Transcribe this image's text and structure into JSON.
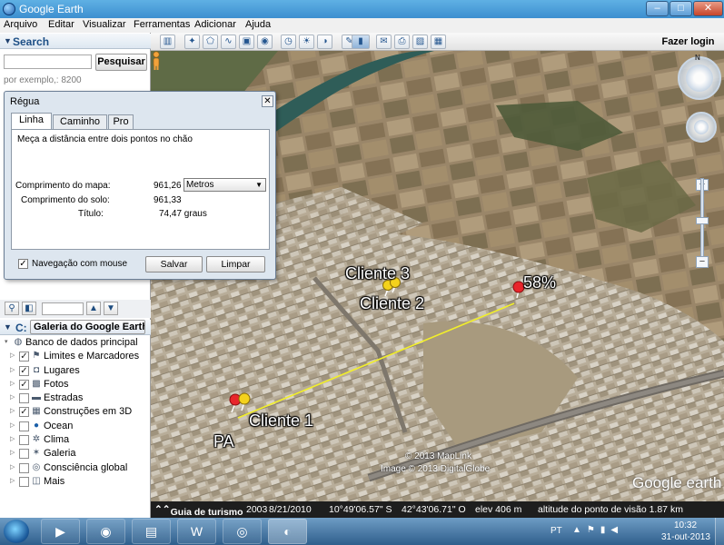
{
  "window": {
    "title": "Google Earth"
  },
  "menu": [
    "Arquivo",
    "Editar",
    "Visualizar",
    "Ferramentas",
    "Adicionar",
    "Ajuda"
  ],
  "search": {
    "header": "Search",
    "button": "Pesquisar",
    "hint": "por exemplo,: 8200"
  },
  "places": {
    "header_cut": "C:"
  },
  "layers": {
    "gallery_button": "Galeria do Google Earth",
    "gallery_chevron": "»",
    "items": [
      {
        "label": "Banco de dados principal",
        "checked": null,
        "icon": "globe-icon",
        "root": true
      },
      {
        "label": "Limites e Marcadores",
        "checked": true,
        "icon": "flag-icon"
      },
      {
        "label": "Lugares",
        "checked": true,
        "icon": "places-icon"
      },
      {
        "label": "Fotos",
        "checked": true,
        "icon": "photo-icon"
      },
      {
        "label": "Estradas",
        "checked": false,
        "icon": "roads-icon"
      },
      {
        "label": "Construções em 3D",
        "checked": true,
        "icon": "buildings-icon"
      },
      {
        "label": "Ocean",
        "checked": false,
        "icon": "ocean-icon"
      },
      {
        "label": "Clima",
        "checked": false,
        "icon": "weather-icon"
      },
      {
        "label": "Galeria",
        "checked": false,
        "icon": "gallery-star-icon"
      },
      {
        "label": "Consciência global",
        "checked": false,
        "icon": "globe-awareness-icon"
      },
      {
        "label": "Mais",
        "checked": false,
        "icon": "more-icon"
      }
    ]
  },
  "toolbar": {
    "login": "Fazer login"
  },
  "ruler": {
    "title": "Régua",
    "tabs": [
      "Linha",
      "Caminho",
      "Pro"
    ],
    "description": "Meça a distância entre dois pontos no chão",
    "map_length_label": "Comprimento do mapa:",
    "map_length_value": "961,26",
    "unit": "Metros",
    "ground_length_label": "Comprimento do solo:",
    "ground_length_value": "961,33",
    "heading_label": "Título:",
    "heading_value": "74,47 graus",
    "mouse_nav_label": "Navegação com mouse",
    "mouse_nav_checked": true,
    "save": "Salvar",
    "clear": "Limpar",
    "close": "✕"
  },
  "map": {
    "labels": {
      "cliente3": "Cliente 3",
      "cliente2": "Cliente 2",
      "pct": "58%",
      "cliente1": "Cliente 1",
      "pa": "PA"
    },
    "copyright1": "© 2013 MapLink",
    "copyright2": "Image © 2013 DigitalGlobe",
    "logo": "Google earth",
    "compass_n": "N"
  },
  "status": {
    "tour": "Guia de turismo",
    "year": "2003",
    "date": "8/21/2010",
    "lat": "10°49'06.57\" S",
    "lon": "42°43'06.71\" O",
    "elev": "elev  406 m",
    "eye": "altitude do ponto de visão  1.87 km"
  },
  "taskbar": {
    "lang": "PT",
    "time": "10:32",
    "date": "31-out-2013",
    "apps": [
      "media-player-icon",
      "firefox-icon",
      "folder-icon",
      "word-icon",
      "chrome-icon",
      "google-earth-icon"
    ],
    "app_glyphs": [
      "▶",
      "◉",
      "▤",
      "W",
      "◎",
      "◐"
    ]
  },
  "colors": {
    "ruler_line": "#f2ef2a",
    "pin_yellow": "#f4d21c",
    "pin_red": "#e8252b"
  }
}
